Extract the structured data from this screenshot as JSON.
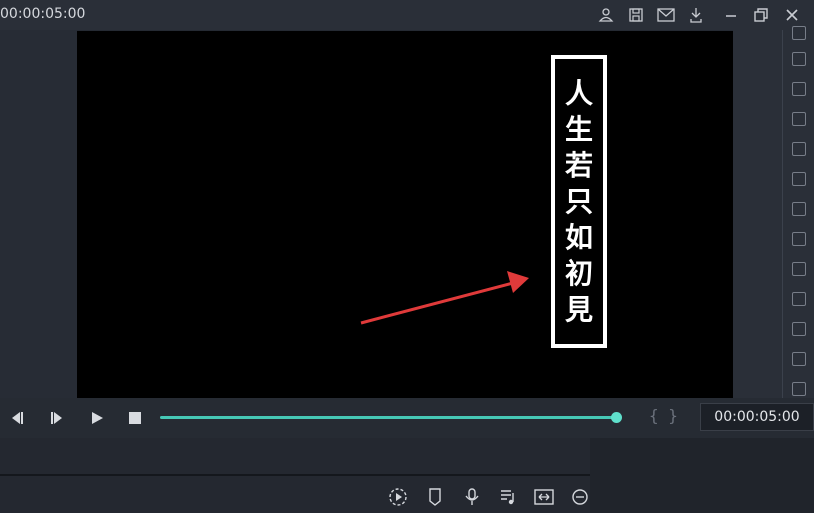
{
  "titlebar": {
    "timecode": "00:00:05:00",
    "icons": [
      "user-icon",
      "save-icon",
      "mail-icon",
      "download-icon",
      "minimize-icon",
      "restore-icon",
      "close-icon"
    ]
  },
  "preview": {
    "poem_text": [
      "人",
      "生",
      "若",
      "只",
      "如",
      "初",
      "見"
    ],
    "arrow_color": "#e03a3a"
  },
  "playback": {
    "progress": 1.0,
    "accent_color": "#46c8b6",
    "braces_label": "{ }",
    "timecode": "00:00:05:00"
  },
  "toolbar": {
    "icons": [
      "render-preview-icon",
      "marker-icon",
      "voiceover-icon",
      "audio-mixer-icon",
      "fit-icon",
      "zoom-out-icon"
    ]
  }
}
